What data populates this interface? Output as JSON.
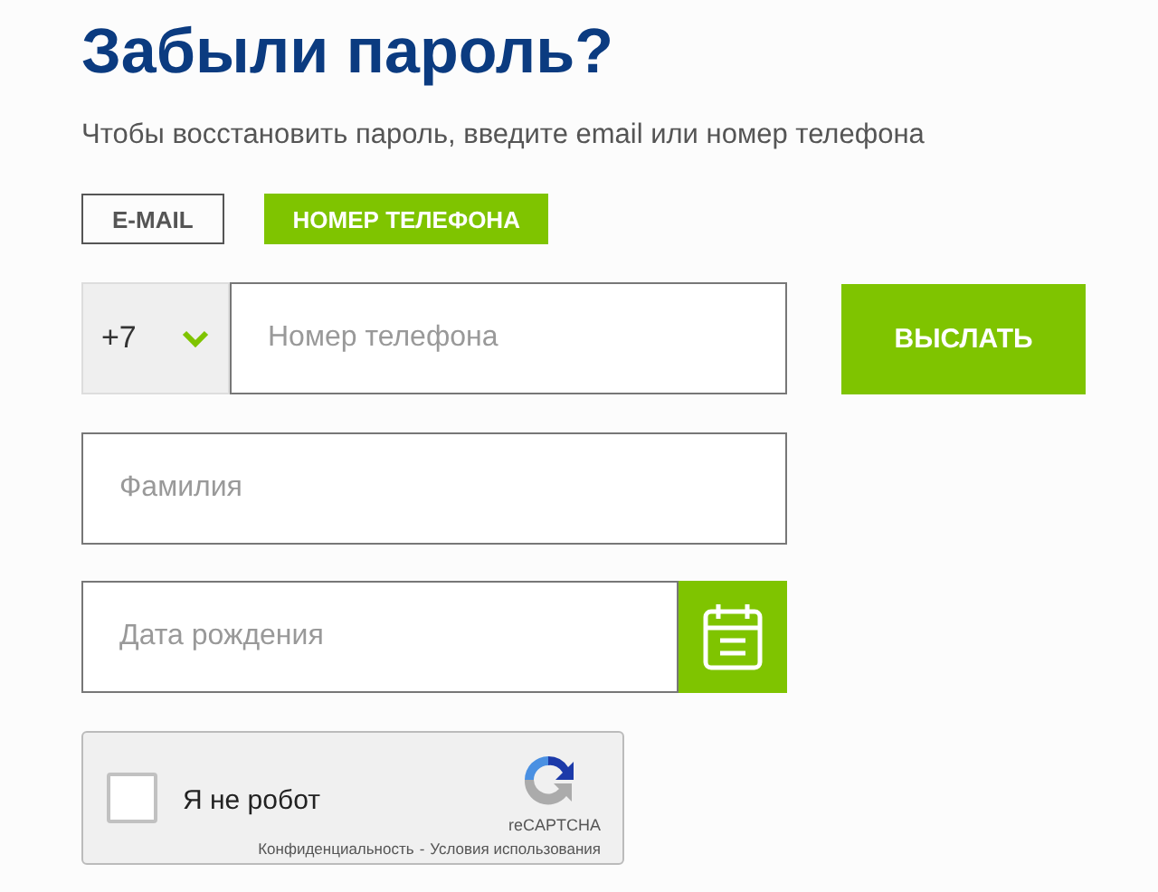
{
  "title": "Забыли пароль?",
  "subtitle": "Чтобы восстановить пароль, введите email или номер телефона",
  "tabs": [
    {
      "label": "E-MAIL",
      "selected": false
    },
    {
      "label": "НОМЕР ТЕЛЕФОНА",
      "selected": true
    }
  ],
  "phone": {
    "code": "+7",
    "placeholder": "Номер телефона"
  },
  "send_button": "ВЫСЛАТЬ",
  "surname": {
    "placeholder": "Фамилия"
  },
  "birthdate": {
    "placeholder": "Дата рождения"
  },
  "captcha": {
    "label": "Я не робот",
    "checked": false,
    "brand": "reCAPTCHA",
    "links": [
      "Конфиденциальность",
      "Условия использования"
    ],
    "separator": "-"
  }
}
